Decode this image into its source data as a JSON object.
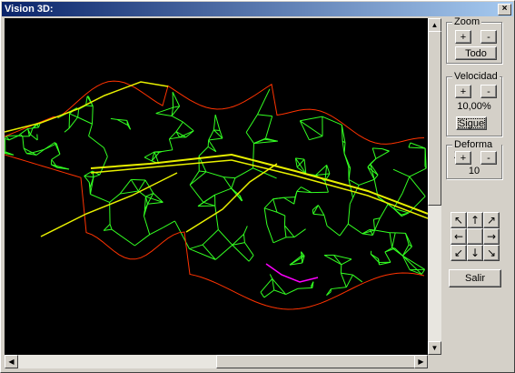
{
  "window": {
    "title": "Vision 3D:",
    "close_label": "×"
  },
  "zoom": {
    "label": "Zoom",
    "plus": "+",
    "minus": "-",
    "all": "Todo"
  },
  "speed": {
    "label": "Velocidad",
    "plus": "+",
    "minus": "-",
    "value": "10,00%",
    "follow": "Sigue"
  },
  "deform": {
    "label": "Deforma Z",
    "plus": "+",
    "minus": "-",
    "value": "10"
  },
  "nav": {
    "nw": "↖",
    "n": "↑",
    "ne": "↗",
    "w": "←",
    "e": "→",
    "sw": "↙",
    "s": "↓",
    "se": "↘"
  },
  "exit_label": "Salir",
  "scroll": {
    "up": "▲",
    "down": "▼",
    "left": "◀",
    "right": "▶"
  },
  "colors": {
    "mesh": "#33ff22",
    "ridge": "#e8f000",
    "boundary": "#ff3300",
    "highlight": "#ff00ff",
    "background": "#000000"
  }
}
